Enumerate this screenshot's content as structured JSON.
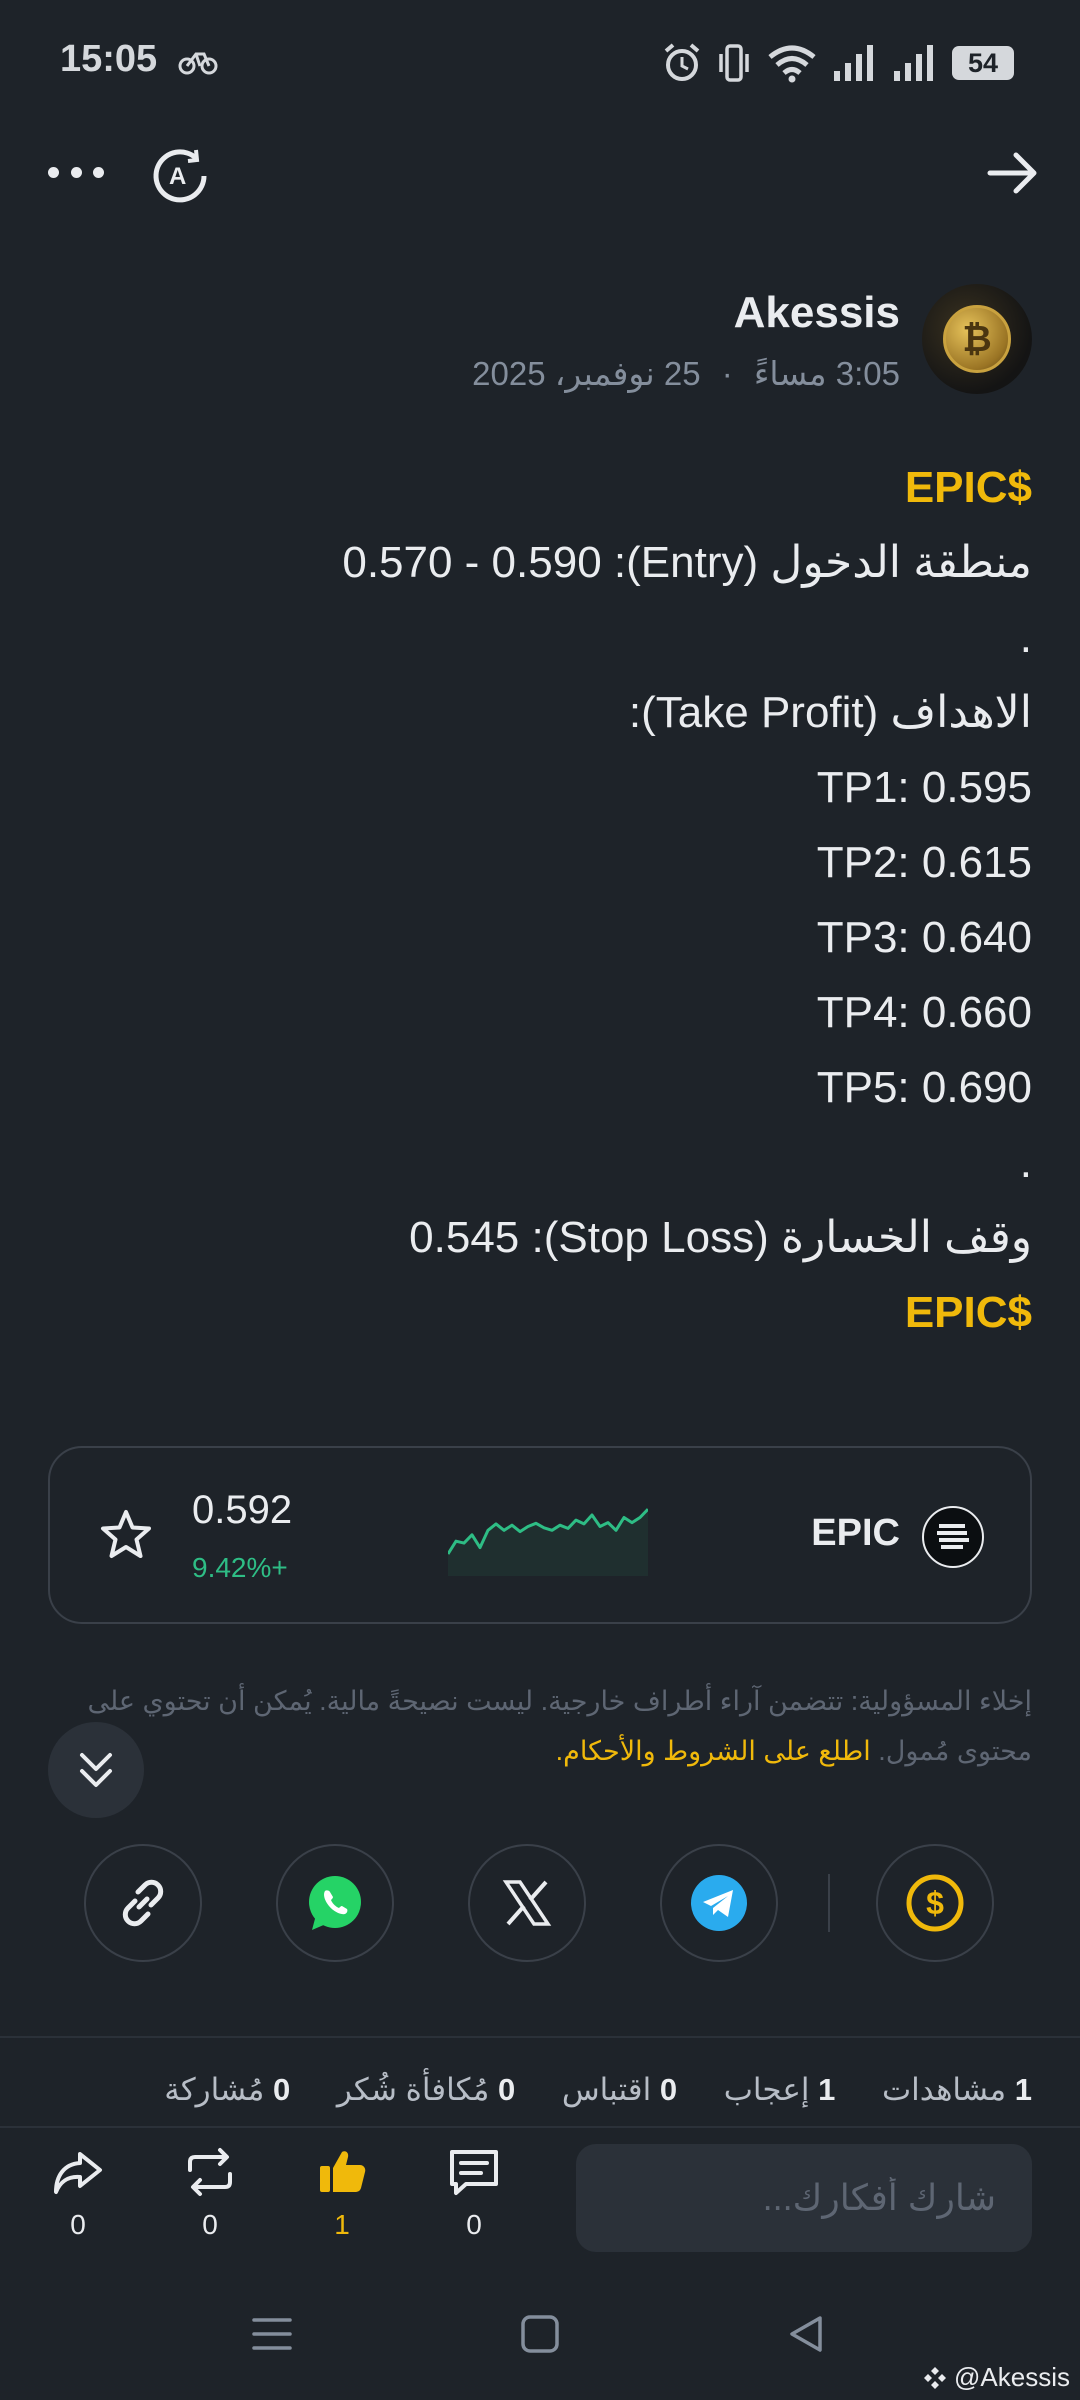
{
  "status_bar": {
    "time": "15:05",
    "battery": "54",
    "icons": [
      "bike-icon",
      "alarm-icon",
      "vibrate-icon",
      "wifi-icon",
      "signal-icon",
      "signal-icon",
      "battery-icon"
    ]
  },
  "top_nav": {
    "more_icon": "more-dots-icon",
    "translate_icon": "translate-icon",
    "back_icon": "arrow-right-icon"
  },
  "author": {
    "name": "Akessis",
    "time": "3:05 مساءً",
    "date": "25 نوفمبر، 2025",
    "separator": "·"
  },
  "post": {
    "lines": [
      {
        "text": "EPIC$",
        "style": "tag"
      },
      {
        "text": "منطقة الدخول (Entry):  0.570 - 0.590",
        "style": "rtl"
      },
      {
        "text": ".",
        "style": "plain"
      },
      {
        "text": "الاهداف (Take Profit):",
        "style": "rtl"
      },
      {
        "text": "TP1: 0.595",
        "style": "plain"
      },
      {
        "text": "TP2: 0.615",
        "style": "plain"
      },
      {
        "text": "TP3: 0.640",
        "style": "plain"
      },
      {
        "text": "TP4: 0.660",
        "style": "plain"
      },
      {
        "text": "TP5: 0.690",
        "style": "plain"
      },
      {
        "text": ".",
        "style": "plain"
      },
      {
        "text": "وقف الخسارة (Stop Loss): 0.545",
        "style": "rtl"
      },
      {
        "text": "EPIC$",
        "style": "tag"
      }
    ]
  },
  "token": {
    "symbol": "EPIC",
    "price": "0.592",
    "change": "9.42%+",
    "change_color": "#2ebd85",
    "sparkline": [
      0.25,
      0.45,
      0.42,
      0.55,
      0.35,
      0.62,
      0.72,
      0.62,
      0.7,
      0.6,
      0.68,
      0.73,
      0.66,
      0.62,
      0.7,
      0.65,
      0.78,
      0.72,
      0.86,
      0.68,
      0.74,
      0.62,
      0.82,
      0.74,
      0.82,
      0.95
    ]
  },
  "disclaimer": {
    "text": "إخلاء المسؤولية: تتضمن آراء أطراف خارجية. ليست نصيحةً مالية. يُمكن أن تحتوي على محتوى مُمول.",
    "link": "اطلع على الشروط والأحكام."
  },
  "share": {
    "buttons": [
      "copy-link",
      "whatsapp",
      "x",
      "telegram",
      "tip"
    ]
  },
  "stats": [
    {
      "count": "1",
      "label": "مشاهدات"
    },
    {
      "count": "1",
      "label": "إعجاب"
    },
    {
      "count": "0",
      "label": "اقتباس"
    },
    {
      "count": "0",
      "label": "مُكافأة شُكر"
    },
    {
      "count": "0",
      "label": "مُشاركة"
    }
  ],
  "actions": {
    "share_count": "0",
    "repost_count": "0",
    "like_count": "1",
    "comment_count": "0",
    "comment_placeholder": "شارك أفكارك..."
  },
  "watermark": "@Akessis",
  "colors": {
    "background": "#1e2329",
    "accent": "#f0b90b",
    "positive": "#2ebd85",
    "muted": "#848e9c"
  }
}
